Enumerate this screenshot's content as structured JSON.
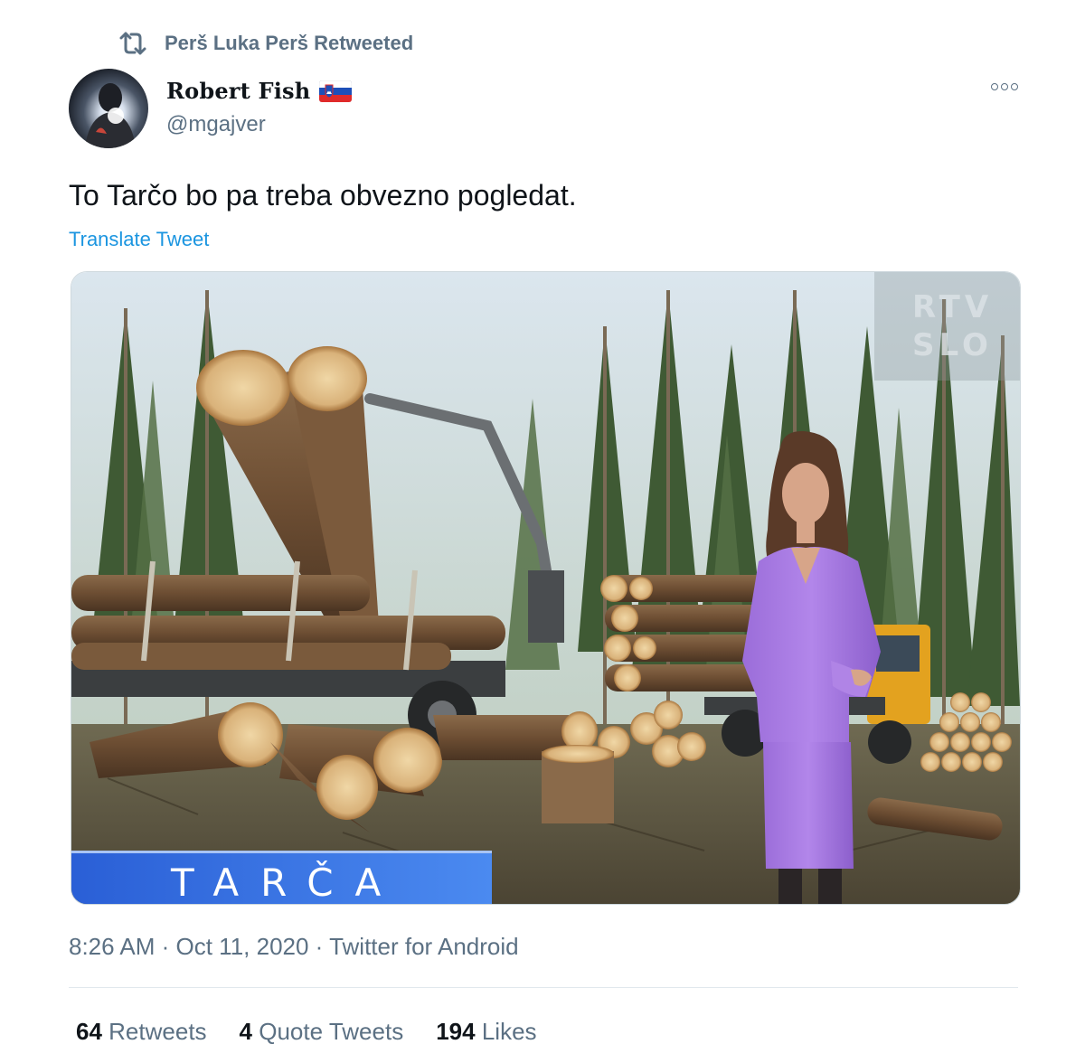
{
  "retweet": {
    "label": "Perš Luka Perš Retweeted",
    "icon": "retweet-icon"
  },
  "author": {
    "name": "Robert Fish",
    "handle": "@mgajver",
    "flag": "slovenia-flag-icon"
  },
  "tweet": {
    "text": "To Tarčo bo pa treba obvezno pogledat.",
    "translate_label": "Translate Tweet"
  },
  "media": {
    "watermark_line1": "RTV",
    "watermark_line2": "SLO",
    "show_title": "TARČA"
  },
  "meta": {
    "text": "8:26 AM · Oct 11, 2020 · Twitter for Android"
  },
  "stats": {
    "retweets_count": "64",
    "retweets_label": "Retweets",
    "quotes_count": "4",
    "quotes_label": "Quote Tweets",
    "likes_count": "194",
    "likes_label": "Likes"
  },
  "colors": {
    "accent": "#1b95e0",
    "secondary_text": "#5b7083",
    "banner_blue": "#2a5fd6",
    "suit_purple": "#a97be0"
  }
}
